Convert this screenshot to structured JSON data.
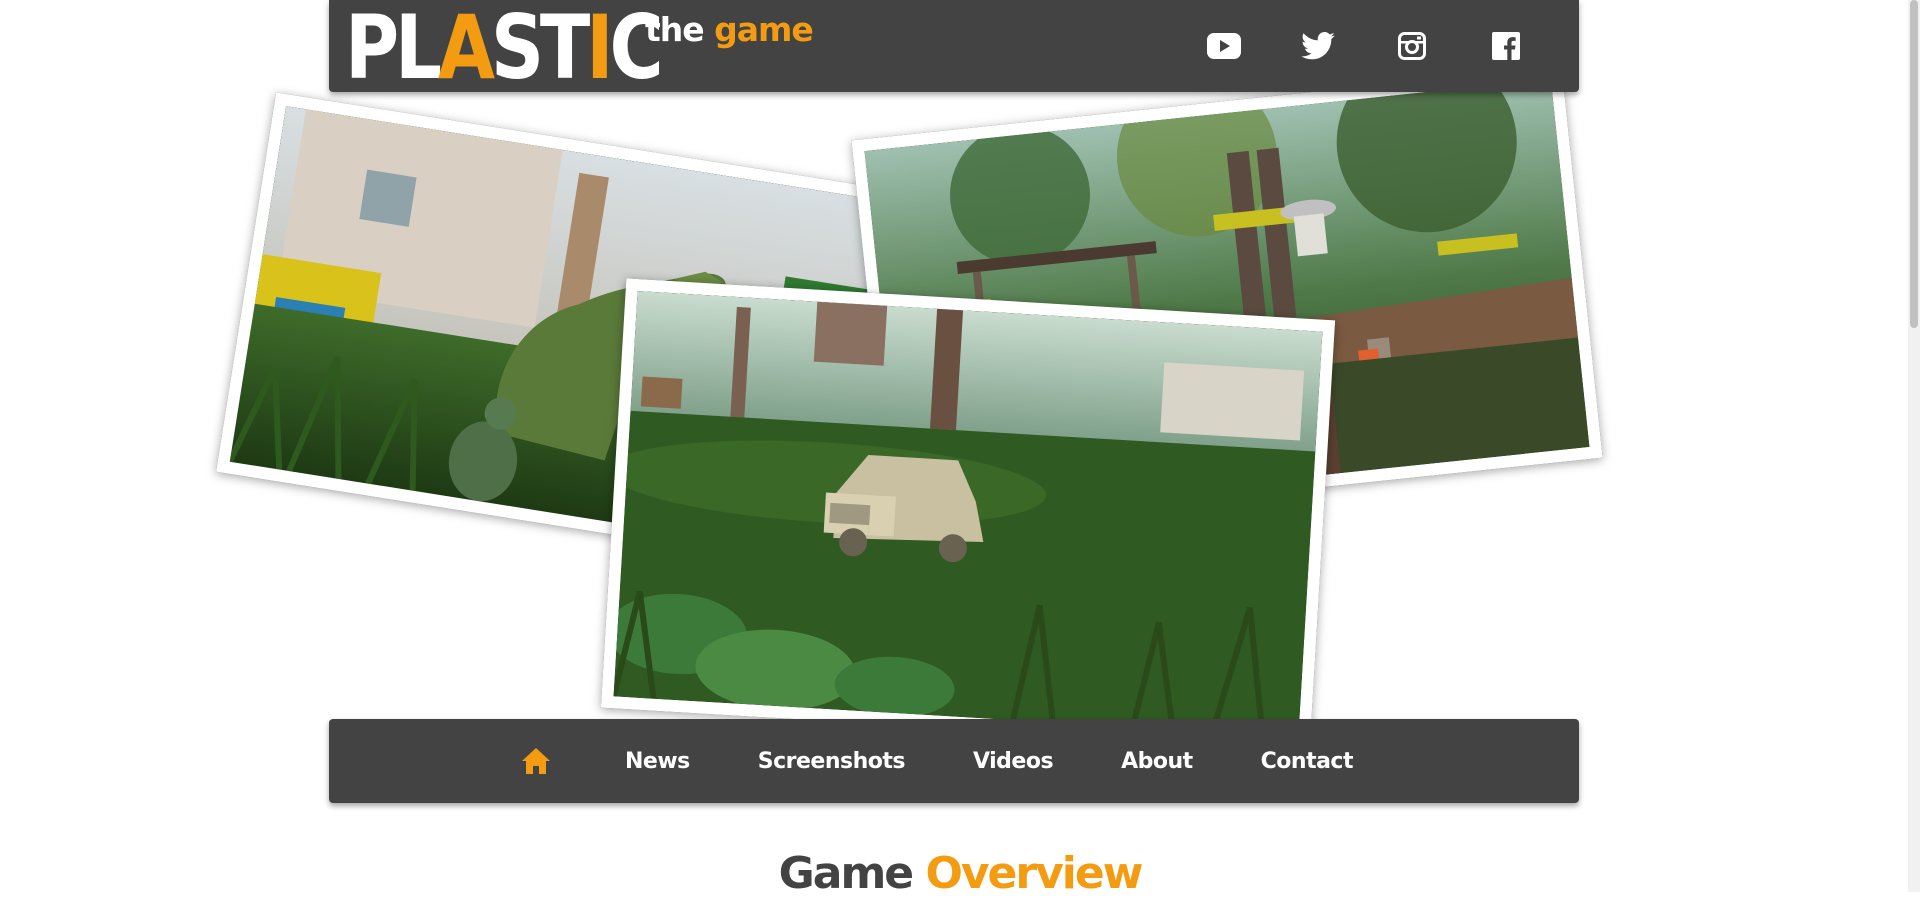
{
  "logo": {
    "word_start": "PL",
    "word_accent_1": "A",
    "word_mid": "ST",
    "word_accent_2": "I",
    "word_end": "C",
    "sub_the": "the",
    "sub_game": "game"
  },
  "socials": [
    {
      "icon": "youtube-icon"
    },
    {
      "icon": "twitter-icon"
    },
    {
      "icon": "instagram-icon"
    },
    {
      "icon": "facebook-icon"
    }
  ],
  "nav": {
    "home_icon": "home-icon",
    "items": [
      {
        "label": "News"
      },
      {
        "label": "Screenshots"
      },
      {
        "label": "Videos"
      },
      {
        "label": "About"
      },
      {
        "label": "Contact"
      }
    ]
  },
  "section": {
    "title_word_1": "Game",
    "title_word_2": "Overview"
  },
  "colors": {
    "bar": "#434343",
    "accent": "#f39c12",
    "text": "#ffffff"
  }
}
